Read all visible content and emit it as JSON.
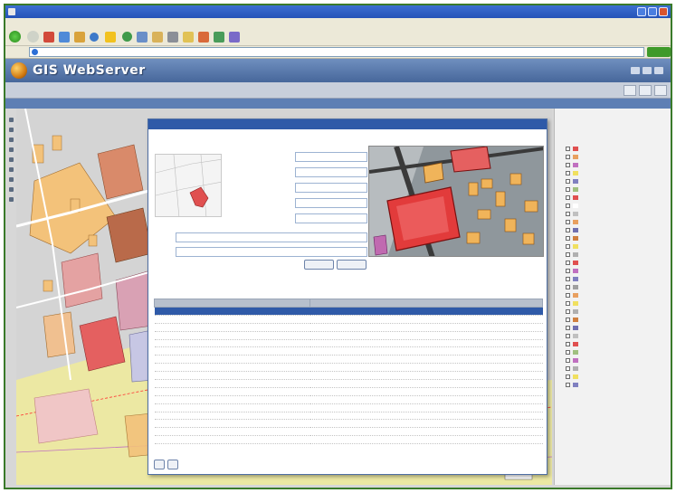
{
  "window": {
    "title": "",
    "menu": [
      "",
      "",
      "",
      "",
      "",
      ""
    ]
  },
  "toolbar": {
    "back_label": "",
    "search_label": "",
    "favorites_label": ""
  },
  "address": {
    "value": "",
    "go_label": ""
  },
  "app": {
    "title": "GIS WebServer",
    "breadcrumb": ""
  },
  "header_tabs": [
    "",
    "",
    ""
  ],
  "dialog": {
    "title": "",
    "caption": "",
    "fields": [
      {
        "label": "",
        "value": ""
      },
      {
        "label": "",
        "value": ""
      },
      {
        "label": "",
        "value": ""
      },
      {
        "label": "",
        "value": ""
      },
      {
        "label": "",
        "value": ""
      }
    ],
    "name_label": "",
    "name_value": "",
    "type_label": "",
    "type_value": "",
    "apply_label": "",
    "cancel_label": "",
    "section_label": "",
    "table": {
      "headers": [
        "",
        ""
      ],
      "rows": [
        [
          "",
          ""
        ],
        [
          "",
          ""
        ],
        [
          "",
          ""
        ],
        [
          "",
          ""
        ],
        [
          "",
          ""
        ],
        [
          "",
          ""
        ],
        [
          "",
          ""
        ],
        [
          "",
          ""
        ],
        [
          "",
          ""
        ],
        [
          "",
          ""
        ],
        [
          "",
          ""
        ],
        [
          "",
          ""
        ],
        [
          "",
          ""
        ],
        [
          "",
          ""
        ],
        [
          "",
          ""
        ],
        [
          "",
          ""
        ],
        [
          "",
          ""
        ]
      ]
    },
    "bottom_buttons": [
      "",
      ""
    ]
  },
  "layers": [
    {
      "label": "",
      "color": "#e05050"
    },
    {
      "label": "",
      "color": "#e8a060"
    },
    {
      "label": "",
      "color": "#c070c0"
    },
    {
      "label": "",
      "color": "#f0e060"
    },
    {
      "label": "",
      "color": "#8080c0"
    },
    {
      "label": "",
      "color": "#a0c080"
    },
    {
      "label": "",
      "color": "#e05050"
    },
    {
      "label": "",
      "color": "#ffffff"
    },
    {
      "label": "",
      "color": "#c0c0c0"
    },
    {
      "label": "",
      "color": "#e8a060"
    },
    {
      "label": "",
      "color": "#7070b0"
    },
    {
      "label": "",
      "color": "#d08040"
    },
    {
      "label": "",
      "color": "#f0e060"
    },
    {
      "label": "",
      "color": "#b0b0b0"
    },
    {
      "label": "",
      "color": "#e05050"
    },
    {
      "label": "",
      "color": "#c070c0"
    },
    {
      "label": "",
      "color": "#8080c0"
    },
    {
      "label": "",
      "color": "#a0a0a0"
    },
    {
      "label": "",
      "color": "#e8a060"
    },
    {
      "label": "",
      "color": "#f0e060"
    },
    {
      "label": "",
      "color": "#b0b0b0"
    },
    {
      "label": "",
      "color": "#d08040"
    },
    {
      "label": "",
      "color": "#7070b0"
    },
    {
      "label": "",
      "color": "#c0c0c0"
    },
    {
      "label": "",
      "color": "#e05050"
    },
    {
      "label": "",
      "color": "#a0c080"
    },
    {
      "label": "",
      "color": "#c070c0"
    },
    {
      "label": "",
      "color": "#b0b0b0"
    },
    {
      "label": "",
      "color": "#f0e060"
    },
    {
      "label": "",
      "color": "#8080c0"
    }
  ],
  "panel_footer": "",
  "colors": {
    "title_bar": "#2553b8",
    "app_header": "#47679b",
    "dialog_title": "#2f5aa8",
    "frame_border": "#3a7a2a",
    "building_red": "#e05050",
    "building_orange": "#e8a060"
  },
  "icons": [
    "ie-icon",
    "back-icon",
    "forward-icon",
    "stop-icon",
    "refresh-icon",
    "home-icon",
    "search-icon",
    "favorites-icon",
    "media-icon",
    "history-icon",
    "mail-icon",
    "print-icon",
    "go-icon",
    "gis-logo-icon"
  ]
}
